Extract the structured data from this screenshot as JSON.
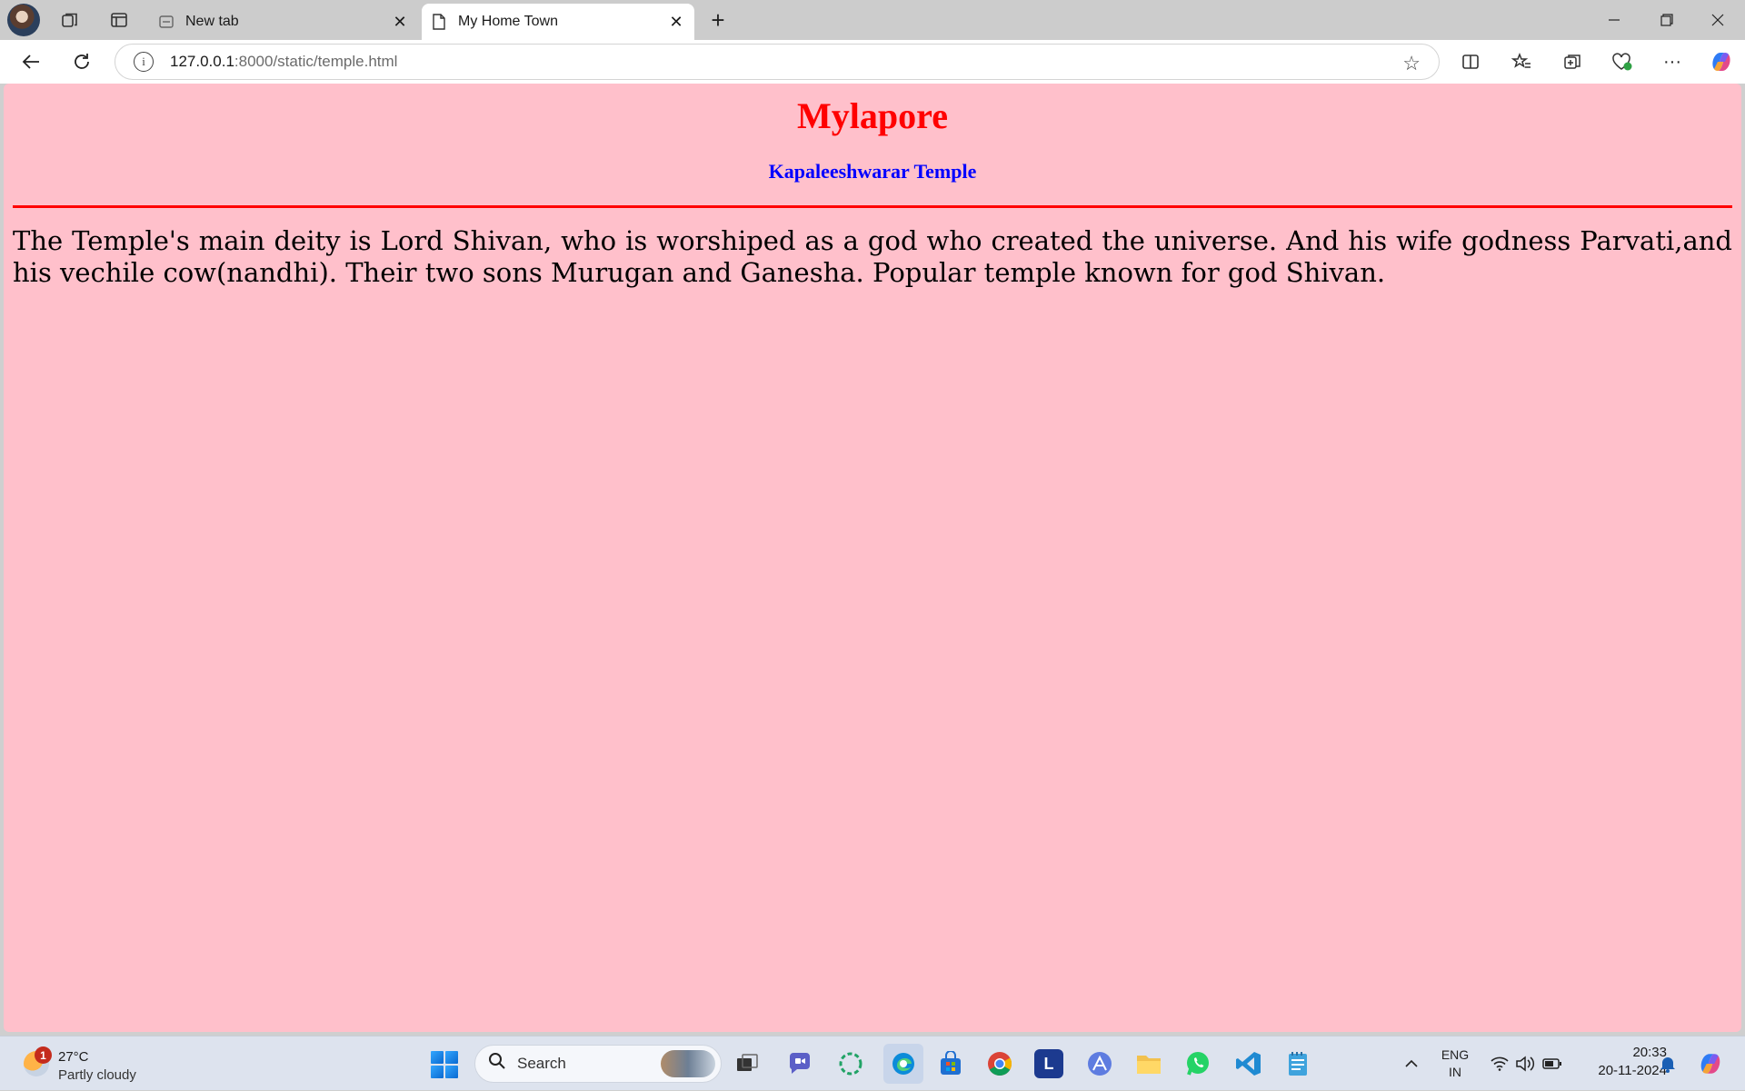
{
  "browser": {
    "tabs": [
      {
        "label": "New tab",
        "active": false
      },
      {
        "label": "My Home Town",
        "active": true
      }
    ],
    "address": {
      "host": "127.0.0.1",
      "rest": ":8000/static/temple.html"
    }
  },
  "page": {
    "heading": "Mylapore",
    "subheading": "Kapaleeshwarar Temple",
    "paragraph": "The Temple's main deity is Lord Shivan, who is worshiped as a god who created the universe. And his wife godness Parvati,and his vechile cow(nandhi). Their two sons Murugan and Ganesha. Popular temple known for god Shivan.",
    "colors": {
      "background": "#ffc0cb",
      "heading": "#ff0000",
      "subheading": "#0000ff",
      "rule": "#ff0000"
    }
  },
  "taskbar": {
    "weather": {
      "badge": "1",
      "temp": "27°C",
      "condition": "Partly cloudy"
    },
    "search_label": "Search",
    "language": {
      "line1": "ENG",
      "line2": "IN"
    },
    "clock": {
      "time": "20:33",
      "date": "20-11-2024"
    }
  }
}
